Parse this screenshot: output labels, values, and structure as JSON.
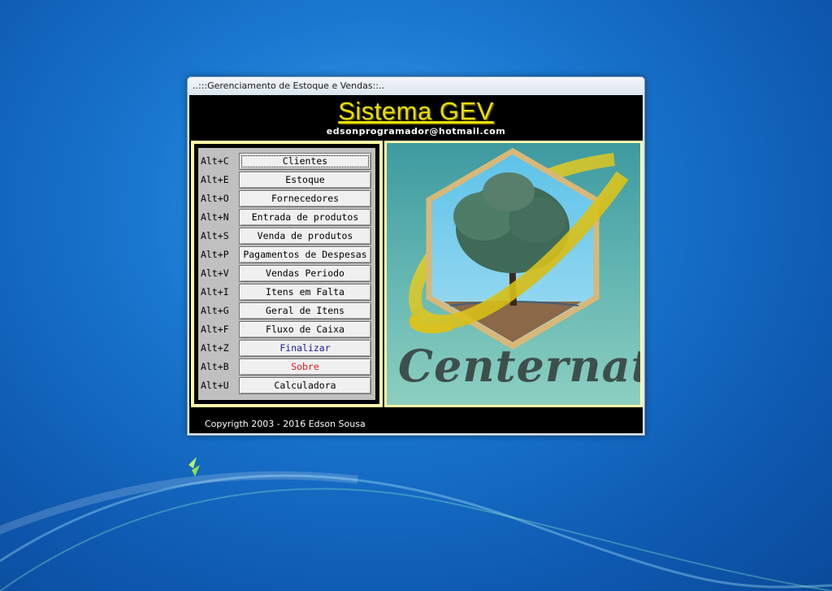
{
  "window": {
    "title": "..:::Gerenciamento de Estoque e Vendas::.."
  },
  "header": {
    "app_title": "Sistema GEV",
    "email": "edsonprogramador@hotmail.com"
  },
  "menu": [
    {
      "shortcut": "Alt+C",
      "label": "Clientes",
      "color": "#000000"
    },
    {
      "shortcut": "Alt+E",
      "label": "Estoque",
      "color": "#000000"
    },
    {
      "shortcut": "Alt+O",
      "label": "Fornecedores",
      "color": "#000000"
    },
    {
      "shortcut": "Alt+N",
      "label": "Entrada de produtos",
      "color": "#000000"
    },
    {
      "shortcut": "Alt+S",
      "label": "Venda de produtos",
      "color": "#000000"
    },
    {
      "shortcut": "Alt+P",
      "label": "Pagamentos de Despesas",
      "color": "#000000"
    },
    {
      "shortcut": "Alt+V",
      "label": "Vendas Periodo",
      "color": "#000000"
    },
    {
      "shortcut": "Alt+I",
      "label": "Itens em Falta",
      "color": "#000000"
    },
    {
      "shortcut": "Alt+G",
      "label": "Geral de Itens",
      "color": "#000000"
    },
    {
      "shortcut": "Alt+F",
      "label": "Fluxo de Caixa",
      "color": "#000000"
    },
    {
      "shortcut": "Alt+Z",
      "label": "Finalizar",
      "color": "#1a1aa0"
    },
    {
      "shortcut": "Alt+B",
      "label": "Sobre",
      "color": "#e01818"
    },
    {
      "shortcut": "Alt+U",
      "label": "Calculadora",
      "color": "#000000"
    }
  ],
  "logo": {
    "text": "Centernat"
  },
  "footer": {
    "copyright": "Copyrigth 2003 - 2016 Edson Sousa"
  }
}
